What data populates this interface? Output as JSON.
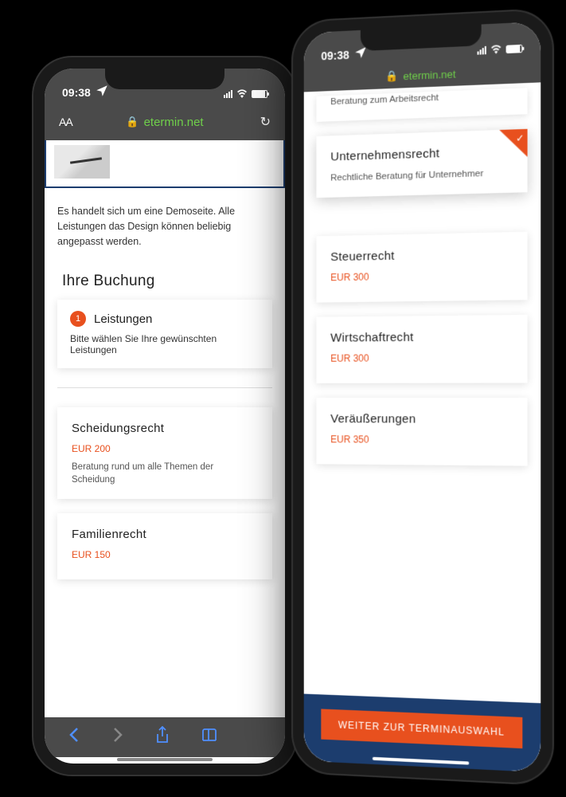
{
  "status": {
    "time": "09:38",
    "location_icon": "location-arrow"
  },
  "browser": {
    "domain": "etermin.net",
    "text_size_label": "AA"
  },
  "left_screen": {
    "demo_notice": "Es handelt sich um eine Demoseite. Alle Leistungen das Design können beliebig angepasst werden.",
    "booking_heading": "Ihre Buchung",
    "step": {
      "number": "1",
      "label": "Leistungen",
      "subtext": "Bitte wählen Sie Ihre gewünschten Leistungen"
    },
    "services": [
      {
        "title": "Scheidungsrecht",
        "price": "EUR 200",
        "desc": "Beratung rund um alle Themen der Scheidung"
      },
      {
        "title": "Familienrecht",
        "price": "EUR 150",
        "desc": ""
      }
    ]
  },
  "right_screen": {
    "top_partial": {
      "desc": "Beratung zum Arbeitsrecht"
    },
    "selected": {
      "title": "Unternehmensrecht",
      "desc": "Rechtliche Beratung für Unternehmer"
    },
    "services": [
      {
        "title": "Steuerrecht",
        "price": "EUR 300"
      },
      {
        "title": "Wirtschaftrecht",
        "price": "EUR 300"
      },
      {
        "title": "Veräußerungen",
        "price": "EUR 350"
      }
    ],
    "cta": "WEITER ZUR TERMINAUSWAHL"
  }
}
